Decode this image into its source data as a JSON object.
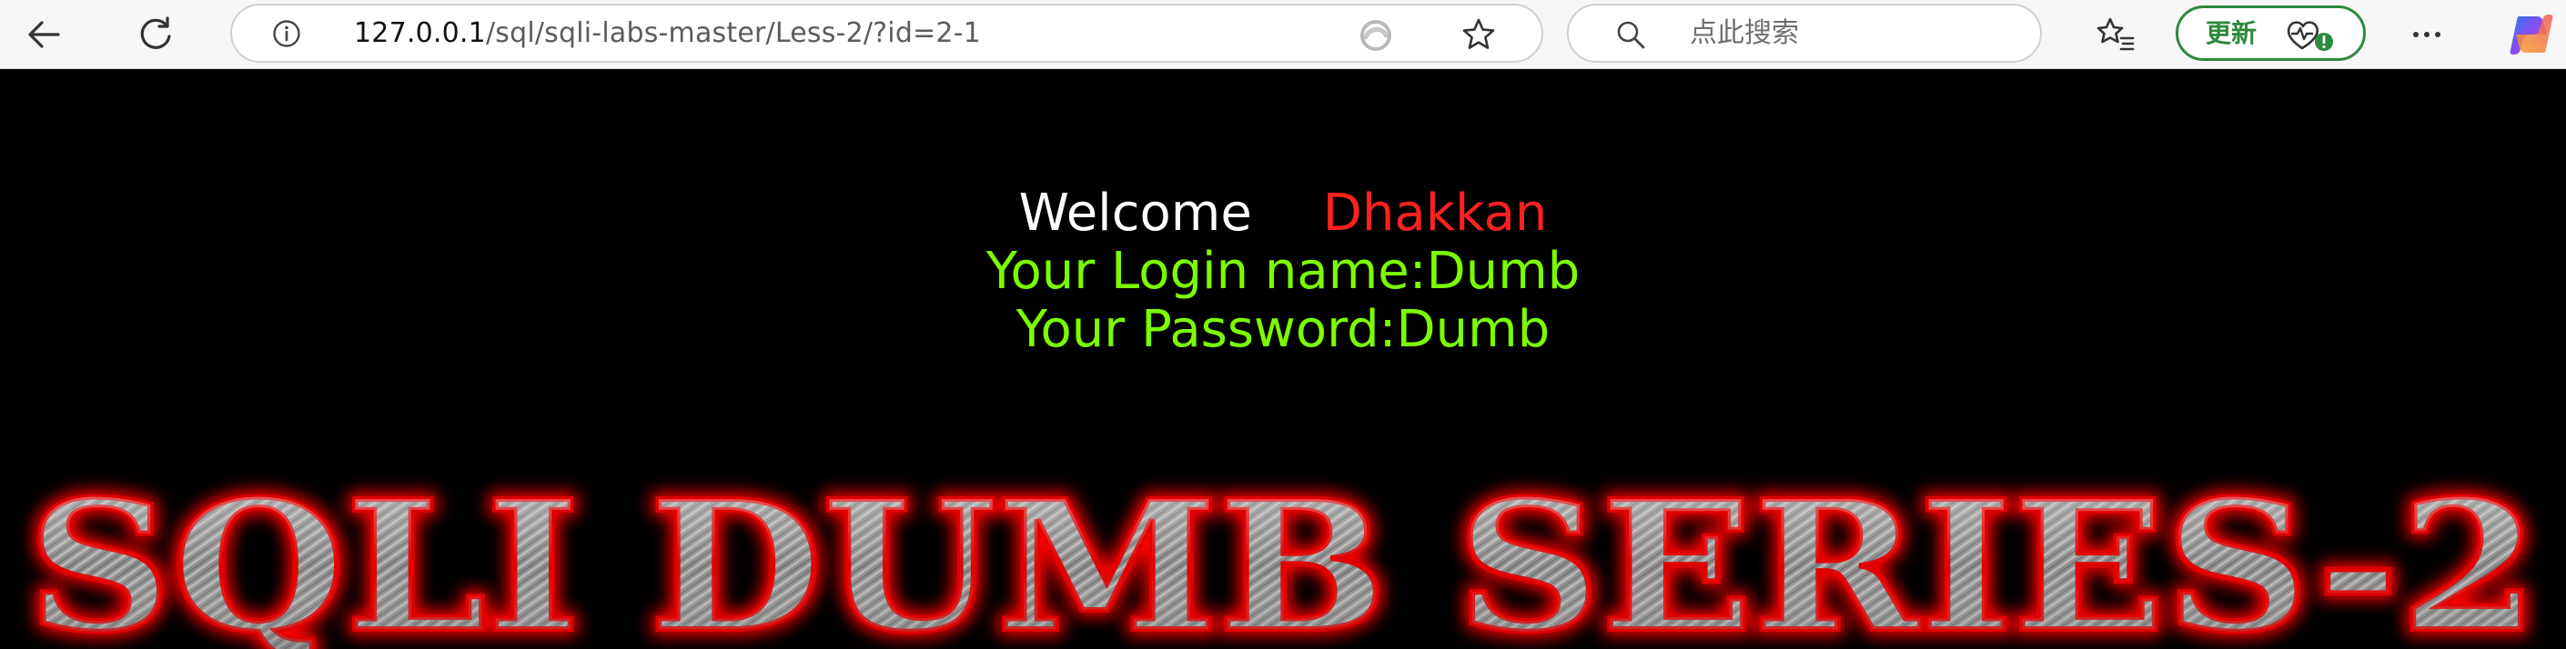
{
  "browser": {
    "url_host": "127.0.0.1",
    "url_path": "/sql/sqli-labs-master/Less-2/?id=2-1",
    "search_placeholder": "点此搜索",
    "update_label": "更新"
  },
  "page": {
    "welcome": "Welcome",
    "user": "Dhakkan",
    "login_name": "Your Login name:Dumb",
    "password": "Your Password:Dumb",
    "banner": "SQLI DUMB SERIES-2"
  },
  "colors": {
    "background": "#000000",
    "welcome": "#ffffff",
    "user": "#ff2020",
    "result_text": "#7cfc00",
    "banner_glow": "#ff0000",
    "update_accent": "#2c8a3d"
  }
}
